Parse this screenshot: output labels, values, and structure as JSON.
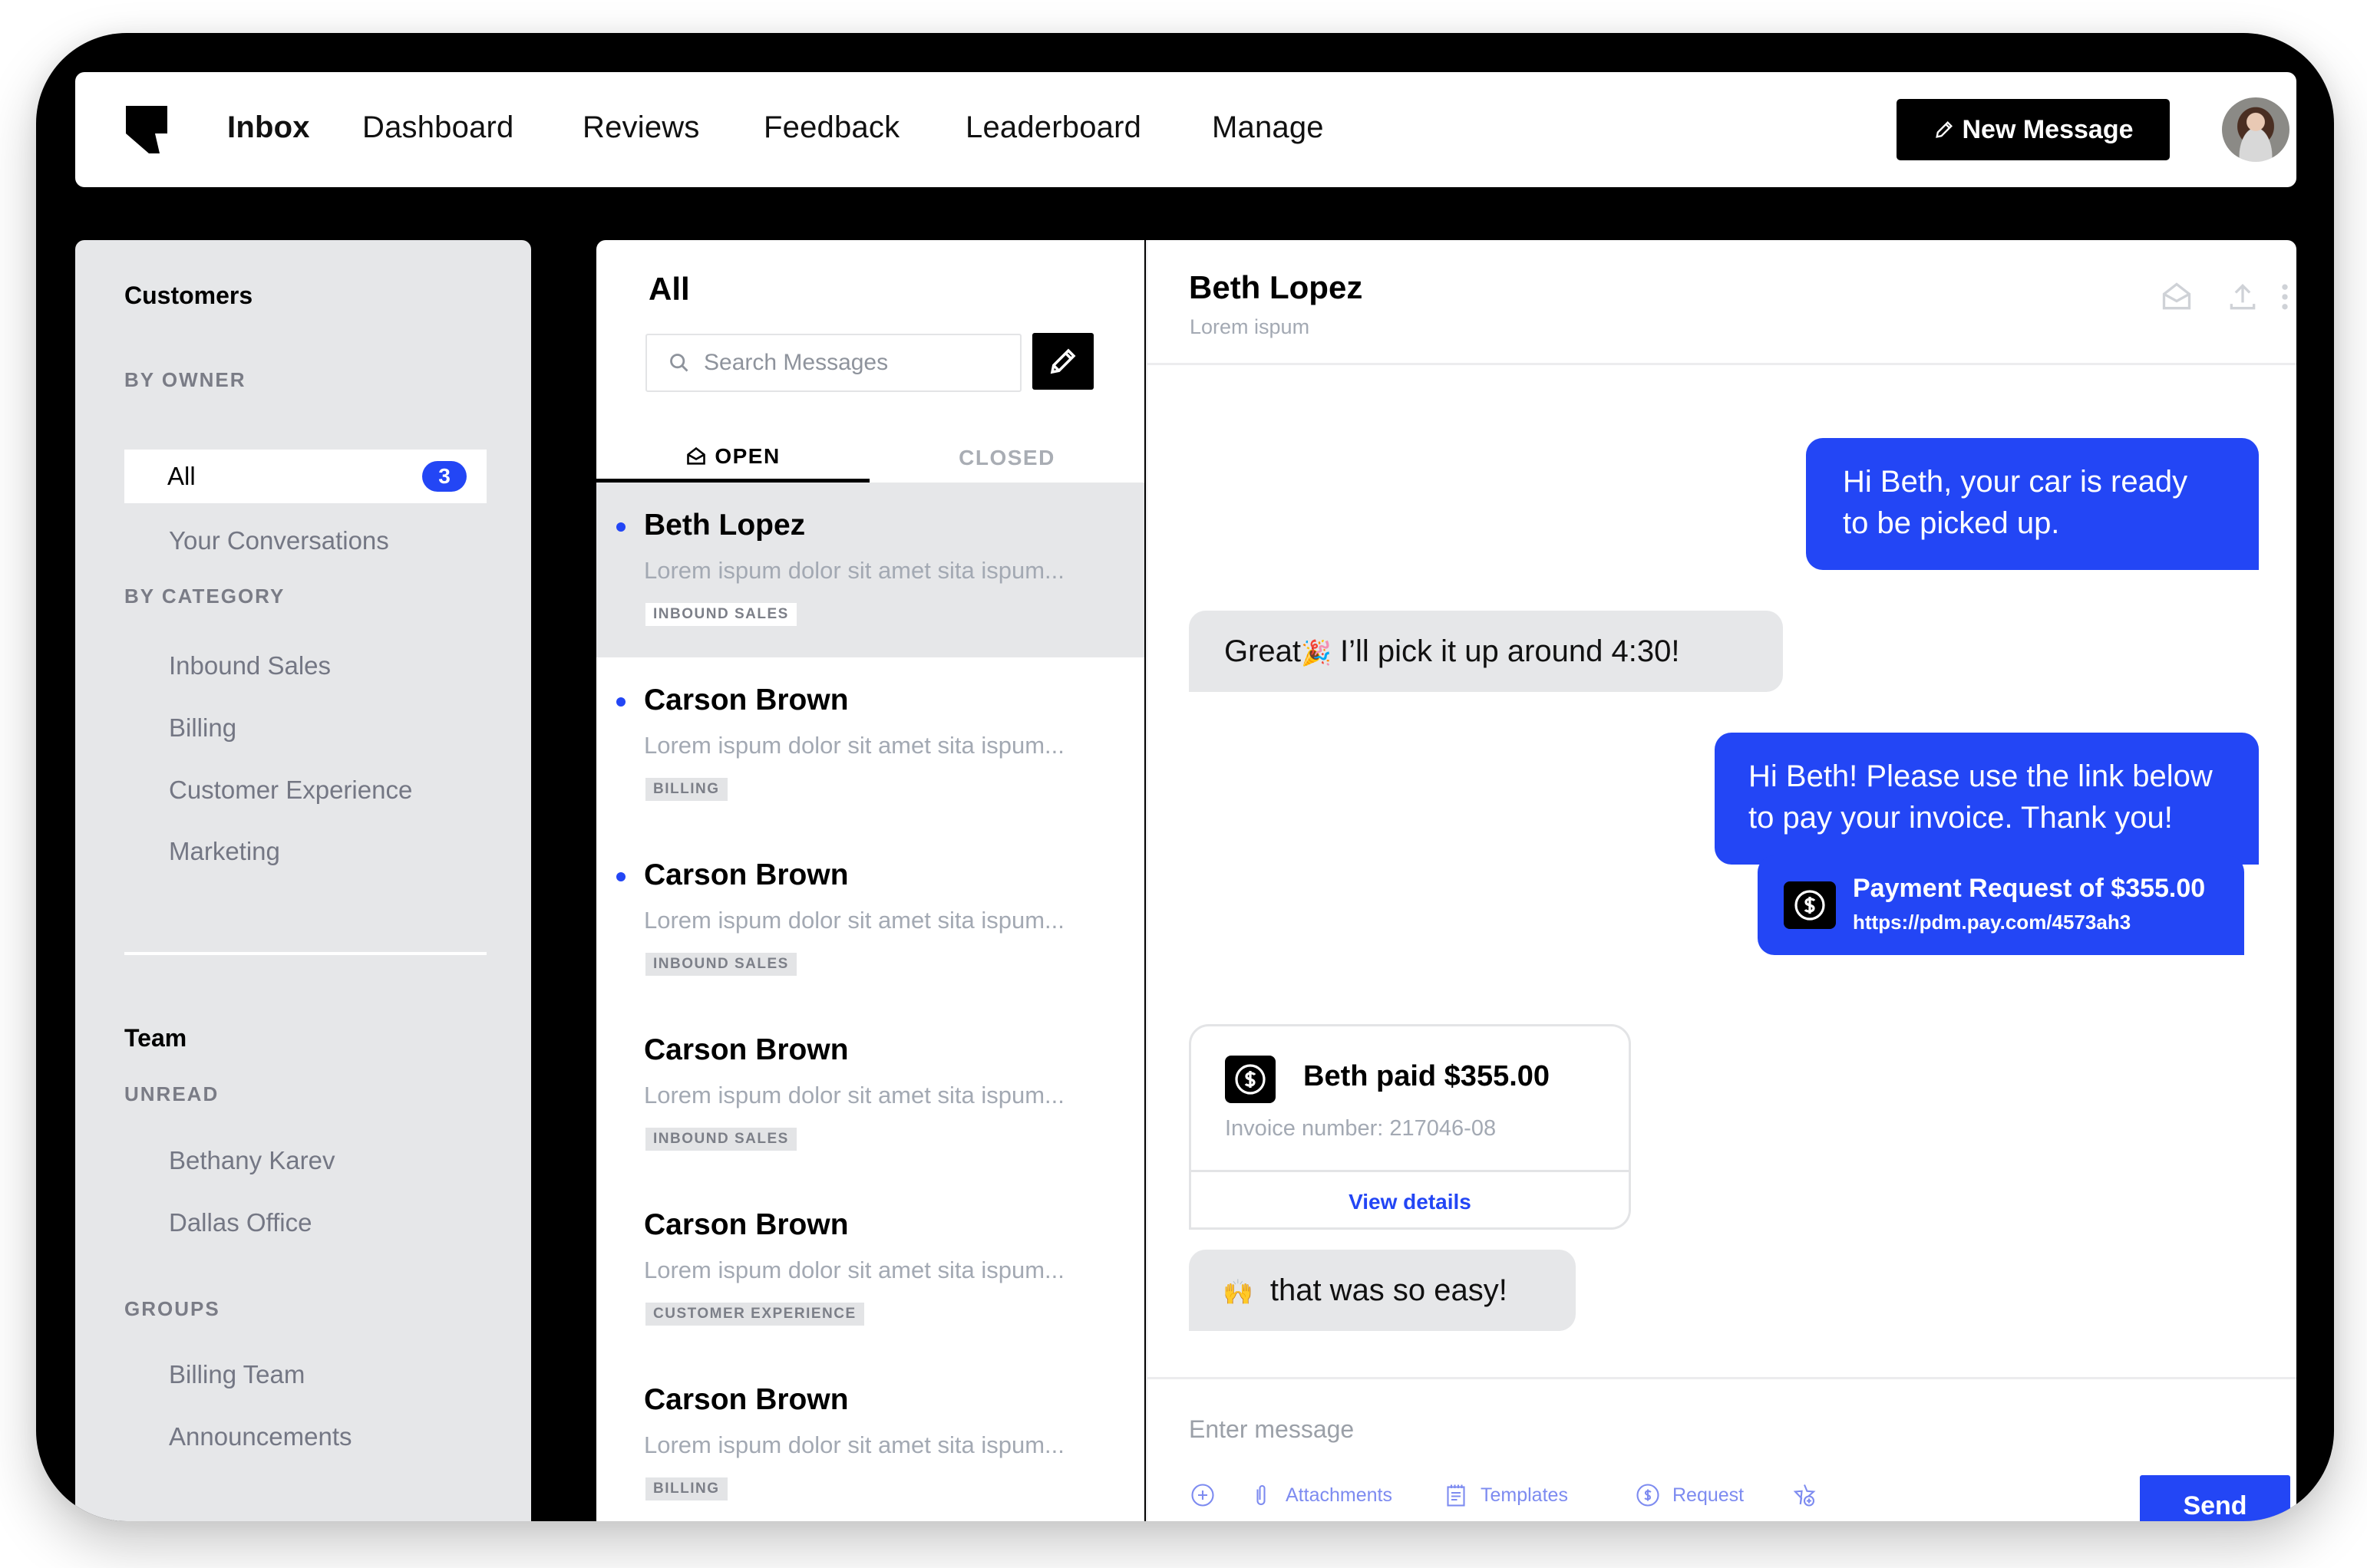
{
  "topnav": {
    "items": [
      {
        "label": "Inbox",
        "active": true
      },
      {
        "label": "Dashboard",
        "active": false
      },
      {
        "label": "Reviews",
        "active": false
      },
      {
        "label": "Feedback",
        "active": false
      },
      {
        "label": "Leaderboard",
        "active": false
      },
      {
        "label": "Manage",
        "active": false
      }
    ],
    "new_message_label": "New Message",
    "avatar_icon": "user-avatar"
  },
  "sidebar": {
    "customers_title": "Customers",
    "by_owner_label": "BY OWNER",
    "owner_items": [
      {
        "label": "All",
        "badge": "3",
        "active": true
      },
      {
        "label": "Your Conversations",
        "active": false
      }
    ],
    "by_category_label": "BY CATEGORY",
    "category_items": [
      "Inbound Sales",
      "Billing",
      "Customer Experience",
      "Marketing"
    ],
    "team_title": "Team",
    "unread_label": "UNREAD",
    "unread_items": [
      "Bethany Karev",
      "Dallas Office"
    ],
    "groups_label": "GROUPS",
    "group_items": [
      "Billing Team",
      "Announcements"
    ]
  },
  "list": {
    "title": "All",
    "search_placeholder": "Search Messages",
    "tabs": [
      {
        "label": "OPEN",
        "icon": "open-envelope-icon",
        "active": true
      },
      {
        "label": "CLOSED",
        "active": false
      }
    ],
    "conversations": [
      {
        "name": "Beth Lopez",
        "preview": "Lorem ispum dolor sit amet sita ispum...",
        "tag": "INBOUND SALES",
        "unread": true,
        "selected": true
      },
      {
        "name": "Carson Brown",
        "preview": "Lorem ispum dolor sit amet sita ispum...",
        "tag": "BILLING",
        "unread": true,
        "selected": false
      },
      {
        "name": "Carson Brown",
        "preview": "Lorem ispum dolor sit amet sita ispum...",
        "tag": "INBOUND SALES",
        "unread": true,
        "selected": false
      },
      {
        "name": "Carson Brown",
        "preview": "Lorem ispum dolor sit amet sita ispum...",
        "tag": "INBOUND SALES",
        "unread": false,
        "selected": false
      },
      {
        "name": "Carson Brown",
        "preview": "Lorem ispum dolor sit amet sita ispum...",
        "tag": "CUSTOMER EXPERIENCE",
        "unread": false,
        "selected": false
      },
      {
        "name": "Carson Brown",
        "preview": "Lorem ispum dolor sit amet sita ispum...",
        "tag": "BILLING",
        "unread": false,
        "selected": false
      }
    ]
  },
  "chat": {
    "contact_name": "Beth Lopez",
    "contact_subtitle": "Lorem ispum",
    "header_icons": [
      "open-envelope-icon",
      "upload-icon",
      "more-vertical-icon"
    ],
    "messages": [
      {
        "direction": "out",
        "lines": [
          "Hi Beth, your car is ready",
          "to be picked up."
        ]
      },
      {
        "direction": "in",
        "text_before": "Great",
        "emoji": "🎉",
        "text_after": " I’ll pick it up around 4:30!"
      },
      {
        "direction": "out",
        "lines": [
          "Hi Beth! Please use the link below",
          "to pay your invoice. Thank you!"
        ]
      }
    ],
    "payment_request": {
      "title": "Payment Request of $355.00",
      "url": "https://pdm.pay.com/4573ah3",
      "icon": "dollar-circle-icon"
    },
    "paid_card": {
      "title": "Beth paid $355.00",
      "invoice": "Invoice number: 217046-08",
      "link_label": "View details",
      "icon": "dollar-circle-icon"
    },
    "last_message": {
      "direction": "in",
      "emoji": "🙌",
      "text": "that was so easy!"
    },
    "composer": {
      "placeholder": "Enter message",
      "tools": [
        {
          "icon": "add-circle-icon",
          "label": ""
        },
        {
          "icon": "paperclip-icon",
          "label": "Attachments"
        },
        {
          "icon": "template-icon",
          "label": "Templates"
        },
        {
          "icon": "dollar-circle-icon",
          "label": "Request"
        },
        {
          "icon": "star-add-icon",
          "label": ""
        }
      ],
      "send_label": "Send"
    }
  },
  "colors": {
    "accent": "#2346f5",
    "sidebar_bg": "#e6e7e9",
    "frame": "#000000"
  }
}
